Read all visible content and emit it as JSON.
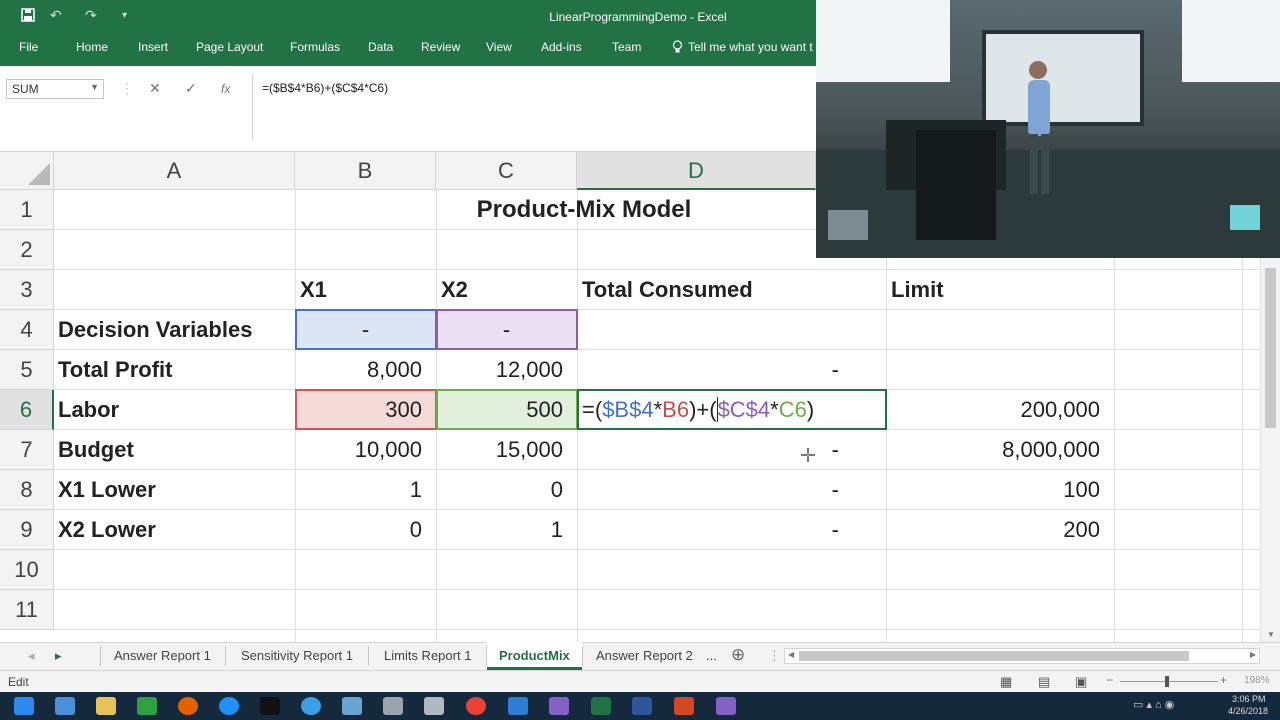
{
  "window": {
    "title": "LinearProgrammingDemo - Excel"
  },
  "ribbon": {
    "tabs": [
      "File",
      "Home",
      "Insert",
      "Page Layout",
      "Formulas",
      "Data",
      "Review",
      "View",
      "Add-ins",
      "Team"
    ],
    "tell_me": "Tell me what you want t"
  },
  "formula_bar": {
    "name_box": "SUM",
    "cancel_symbol": "✕",
    "enter_symbol": "✓",
    "fx_symbol": "fx",
    "formula": "=($B$4*B6)+($C$4*C6)"
  },
  "columns": [
    "A",
    "B",
    "C",
    "D"
  ],
  "rows": [
    "1",
    "2",
    "3",
    "4",
    "5",
    "6",
    "7",
    "8",
    "9",
    "10",
    "11"
  ],
  "sheet": {
    "title": "Product-Mix Model",
    "headers": {
      "b": "X1",
      "c": "X2",
      "d": "Total Consumed",
      "e": "Limit"
    },
    "row4": {
      "label": "Decision Variables",
      "b": "-",
      "c": "-"
    },
    "row5": {
      "label": "Total Profit",
      "b": "8,000",
      "c": "12,000",
      "d": "-"
    },
    "row6": {
      "label": "Labor",
      "b": "300",
      "c": "500",
      "d_prefix": "=(",
      "d_ref1": "$B$4",
      "d_mid1": "*",
      "d_ref2": "B6",
      "d_mid2": ")+(",
      "d_ref3": "$C$4",
      "d_mid3": "*",
      "d_ref4": "C6",
      "d_suffix": ")",
      "e": "200,000"
    },
    "row7": {
      "label": "Budget",
      "b": "10,000",
      "c": "15,000",
      "d": "-",
      "e": "8,000,000"
    },
    "row8": {
      "label": "X1 Lower",
      "b": "1",
      "c": "0",
      "d": "-",
      "e": "100"
    },
    "row9": {
      "label": "X2 Lower",
      "b": "0",
      "c": "1",
      "d": "-",
      "e": "200"
    }
  },
  "sheet_tabs": [
    "Answer Report 1",
    "Sensitivity Report 1",
    "Limits Report 1",
    "ProductMix",
    "Answer Report 2",
    "..."
  ],
  "active_sheet": "ProductMix",
  "status": {
    "mode": "Edit",
    "zoom": "198%"
  },
  "clock": {
    "time": "3:06 PM",
    "date": "4/26/2018"
  },
  "colors": {
    "excel_green": "#217346",
    "ref_blue": "#4472c4",
    "ref_purple": "#7030a0",
    "ref_red": "#c00000",
    "ref_green": "#70ad47"
  }
}
